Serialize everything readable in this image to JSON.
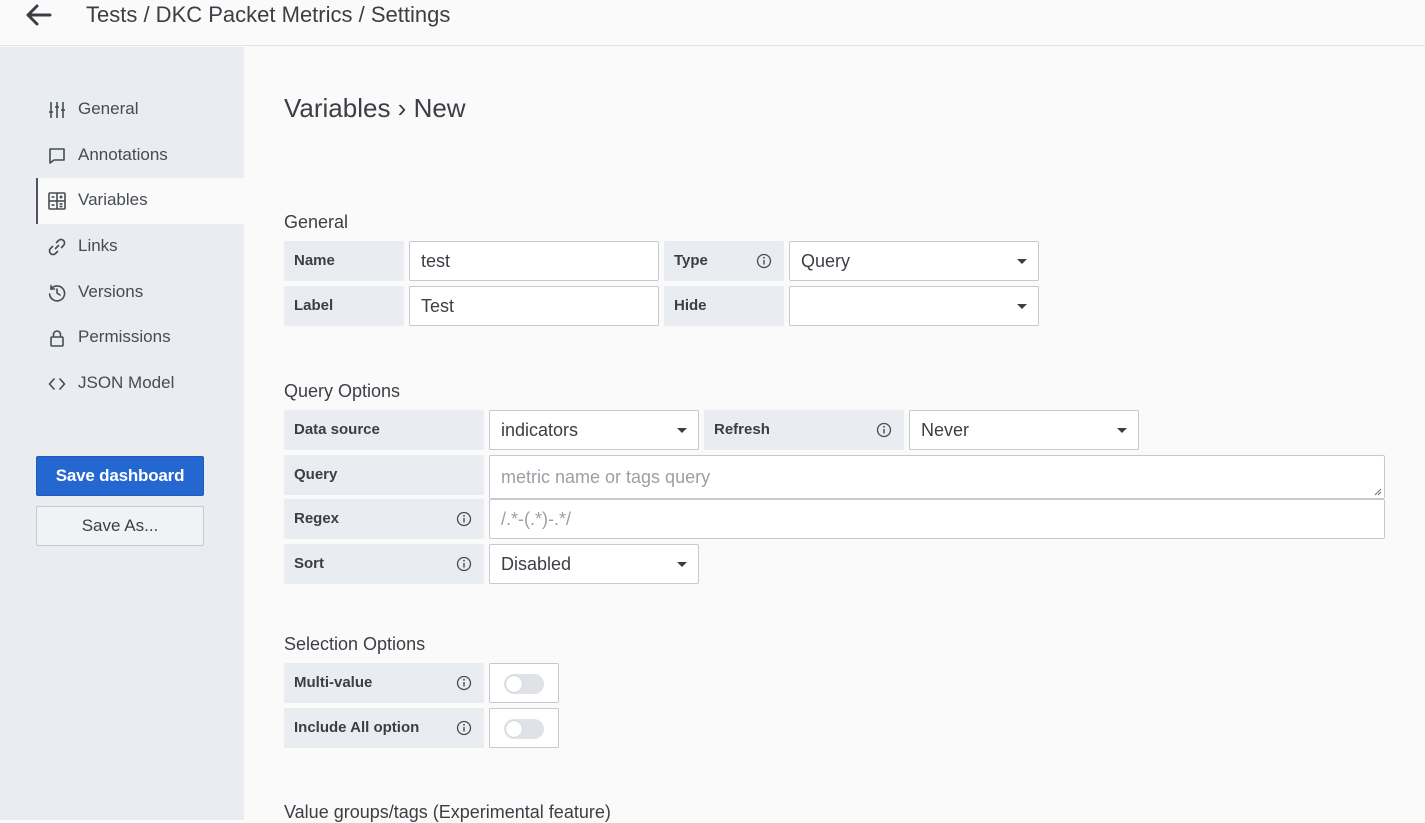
{
  "header": {
    "breadcrumb": "Tests / DKC Packet Metrics / Settings",
    "back_icon": "arrow-left-icon"
  },
  "sidebar": {
    "items": [
      {
        "label": "General",
        "icon": "sliders-icon"
      },
      {
        "label": "Annotations",
        "icon": "comment-icon"
      },
      {
        "label": "Variables",
        "icon": "calculator-icon",
        "active": true
      },
      {
        "label": "Links",
        "icon": "link-icon"
      },
      {
        "label": "Versions",
        "icon": "history-icon"
      },
      {
        "label": "Permissions",
        "icon": "lock-icon"
      },
      {
        "label": "JSON Model",
        "icon": "code-icon"
      }
    ],
    "save_label": "Save dashboard",
    "save_as_label": "Save As..."
  },
  "main": {
    "title": "Variables › New",
    "general": {
      "heading": "General",
      "name_label": "Name",
      "name_value": "test",
      "type_label": "Type",
      "type_value": "Query",
      "label_label": "Label",
      "label_value": "Test",
      "hide_label": "Hide",
      "hide_value": ""
    },
    "query_options": {
      "heading": "Query Options",
      "datasource_label": "Data source",
      "datasource_value": "indicators",
      "refresh_label": "Refresh",
      "refresh_value": "Never",
      "query_label": "Query",
      "query_placeholder": "metric name or tags query",
      "regex_label": "Regex",
      "regex_placeholder": "/.*-(.*)-.*/",
      "sort_label": "Sort",
      "sort_value": "Disabled"
    },
    "selection_options": {
      "heading": "Selection Options",
      "multi_label": "Multi-value",
      "multi_enabled": false,
      "include_all_label": "Include All option",
      "include_all_enabled": false
    },
    "value_groups_heading": "Value groups/tags (Experimental feature)"
  },
  "colors": {
    "primary": "#2467d0",
    "sidebar_bg": "#e9ecf0",
    "label_bg": "#e9ecf0"
  }
}
